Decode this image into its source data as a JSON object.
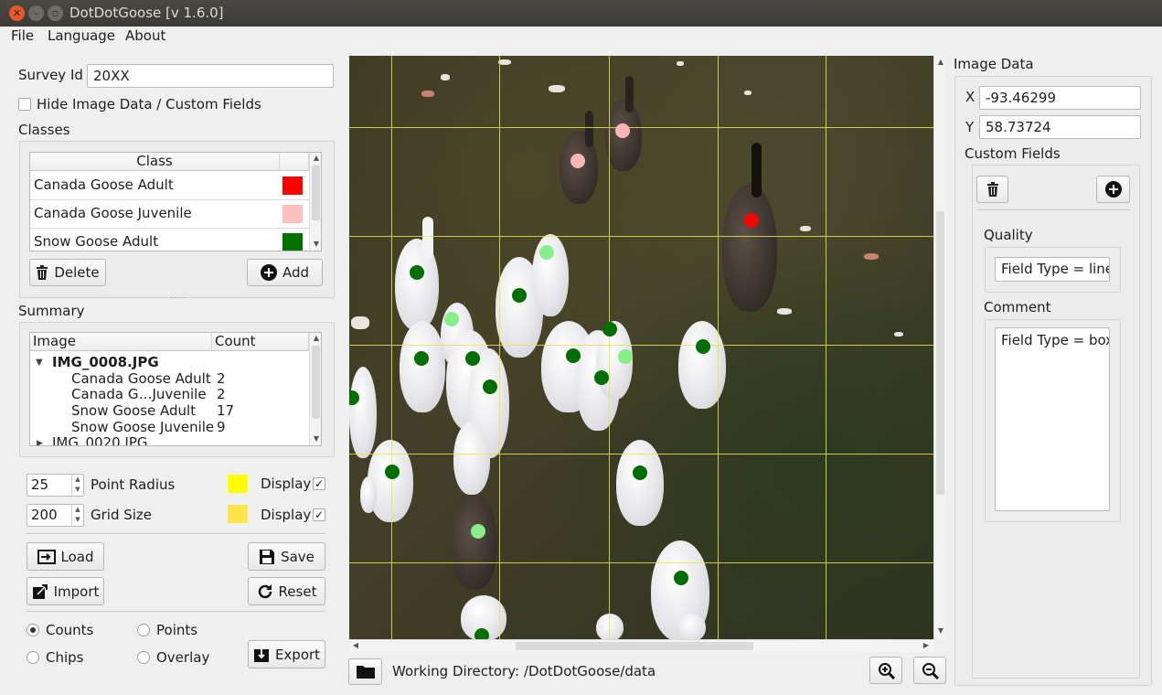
{
  "window": {
    "title": "DotDotGoose [v 1.6.0]"
  },
  "menu": {
    "items": [
      "File",
      "Language",
      "About"
    ]
  },
  "survey": {
    "label": "Survey Id",
    "value": "20XX",
    "hide_label": "Hide Image Data / Custom Fields"
  },
  "classes": {
    "section_label": "Classes",
    "header": "Class",
    "rows": [
      {
        "name": "Canada Goose Adult",
        "color": "#ff0000"
      },
      {
        "name": "Canada Goose Juvenile",
        "color": "#ffc0c0"
      },
      {
        "name": "Snow Goose Adult",
        "color": "#007000"
      }
    ],
    "delete_label": "Delete",
    "add_label": "Add"
  },
  "summary": {
    "section_label": "Summary",
    "col_image": "Image",
    "col_count": "Count",
    "image1": "IMG_0008.JPG",
    "entries": [
      {
        "name": "Canada Goose Adult",
        "count": "2"
      },
      {
        "name": "Canada G…Juvenile",
        "count": "2"
      },
      {
        "name": "Snow Goose Adult",
        "count": "17"
      },
      {
        "name": "Snow Goose Juvenile",
        "count": "9"
      }
    ],
    "image2": "IMG_0020.JPG"
  },
  "settings": {
    "point_radius": "25",
    "point_radius_label": "Point Radius",
    "point_color": "#ffff00",
    "grid_size": "200",
    "grid_size_label": "Grid Size",
    "grid_color": "#ffe44a",
    "display_label": "Display"
  },
  "actions": {
    "load": "Load",
    "save": "Save",
    "import": "Import",
    "reset": "Reset",
    "export": "Export"
  },
  "export_options": {
    "counts": "Counts",
    "points": "Points",
    "chips": "Chips",
    "overlay": "Overlay",
    "selected": "counts"
  },
  "image_data": {
    "section_label": "Image Data",
    "x_label": "X",
    "x_value": "-93.46299",
    "y_label": "Y",
    "y_value": "58.73724",
    "custom_fields_label": "Custom Fields",
    "quality_label": "Quality",
    "quality_value": "Field Type = line",
    "comment_label": "Comment",
    "comment_value": "Field Type = box"
  },
  "status": {
    "working_dir_label": "Working Directory:",
    "working_dir_value": "/DotDotGoose/data"
  }
}
